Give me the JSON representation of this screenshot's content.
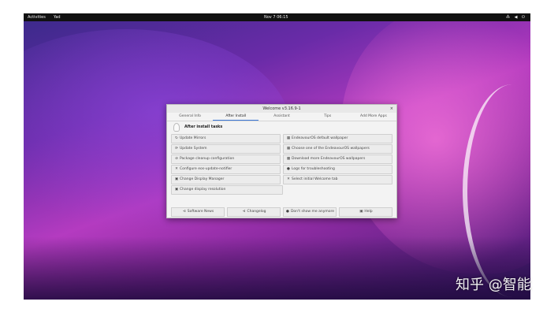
{
  "topbar": {
    "activities": "Activities",
    "app": "Yad",
    "clock": "Nov 7  06:15",
    "tray": "⁂ ◀ ⏻"
  },
  "window": {
    "title": "Welcome v3.16.9-1",
    "close": "×"
  },
  "tabs": [
    "General Info",
    "After Install",
    "Assistant",
    "Tips",
    "Add More Apps"
  ],
  "active_tab": "After Install",
  "section": {
    "title": "After install tasks"
  },
  "rows": [
    [
      {
        "label": "Update Mirrors",
        "icon": "refresh-icon",
        "glyph": "↻"
      },
      {
        "label": "EndeavourOS default wallpaper",
        "icon": "wallpaper-icon",
        "glyph": "▦"
      }
    ],
    [
      {
        "label": "Update System",
        "icon": "update-icon",
        "glyph": "⟳"
      },
      {
        "label": "Choose one of the EndeavourOS wallpapers",
        "icon": "wallpaper-icon",
        "glyph": "▦"
      }
    ],
    [
      {
        "label": "Package cleanup configuration",
        "icon": "cleanup-icon",
        "glyph": "⊘"
      },
      {
        "label": "Download more EndeavourOS wallpapers",
        "icon": "wallpaper-icon",
        "glyph": "▦"
      }
    ],
    [
      {
        "label": "Configure eos-update-notifier",
        "icon": "tools-icon",
        "glyph": "✕"
      },
      {
        "label": "Logs for troubleshooting",
        "icon": "logs-icon",
        "glyph": "●"
      }
    ],
    [
      {
        "label": "Change Display Manager",
        "icon": "display-icon",
        "glyph": "▣"
      },
      {
        "label": "Select initial Welcome tab",
        "icon": "tools-icon",
        "glyph": "✕"
      }
    ],
    [
      {
        "label": "Change display resolution",
        "icon": "display-icon",
        "glyph": "▣"
      },
      null
    ]
  ],
  "bottom_buttons": [
    {
      "label": "Software News",
      "icon": "news-icon",
      "glyph": "⊲"
    },
    {
      "label": "Changelog",
      "icon": "changelog-icon",
      "glyph": "⊲"
    },
    {
      "label": "Don't show me anymore",
      "icon": "dont-show-icon",
      "glyph": "●"
    },
    {
      "label": "Help",
      "icon": "help-icon",
      "glyph": "▣"
    }
  ],
  "watermark": "知乎 @智能"
}
